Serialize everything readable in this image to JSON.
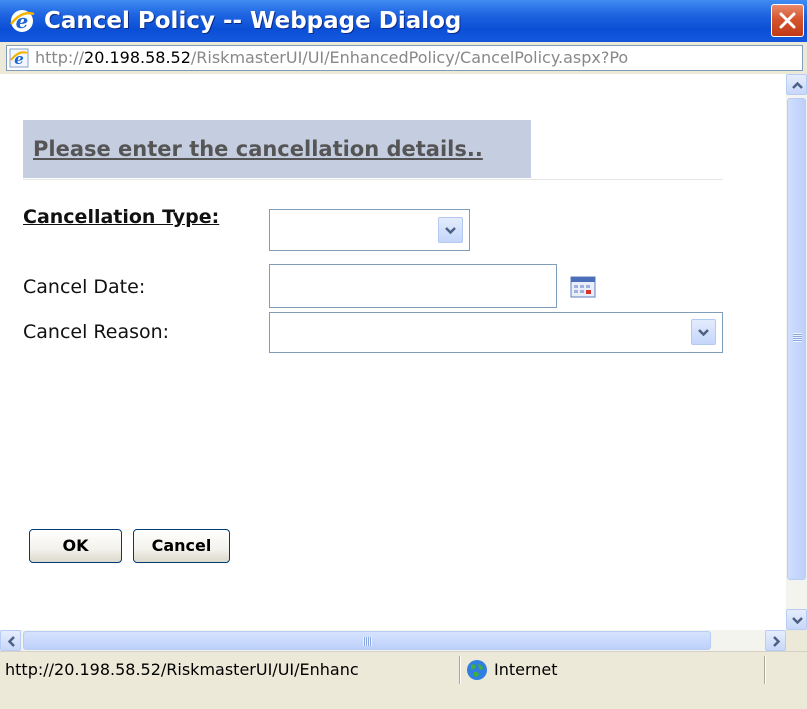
{
  "window": {
    "title": "Cancel Policy -- Webpage Dialog",
    "icon": "ie-icon"
  },
  "address": {
    "scheme": "http://",
    "host": "20.198.58.52",
    "path": "/RiskmasterUI/UI/EnhancedPolicy/CancelPolicy.aspx?Po"
  },
  "form": {
    "message": "Please enter the cancellation details..",
    "cancellation_type_label": "Cancellation Type:",
    "cancellation_type_value": "",
    "cancel_date_label": "Cancel Date:",
    "cancel_date_value": "",
    "cancel_reason_label": "Cancel Reason:",
    "cancel_reason_value": ""
  },
  "buttons": {
    "ok": "OK",
    "cancel": "Cancel"
  },
  "status": {
    "url": "http://20.198.58.52/RiskmasterUI/UI/Enhanc",
    "zone": "Internet"
  },
  "colors": {
    "titlebar": "#0a4fd6",
    "message_bg": "#c5cee1"
  }
}
